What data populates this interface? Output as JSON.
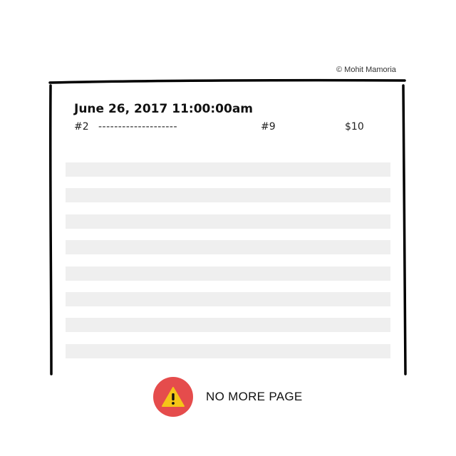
{
  "credit": "© Mohit Mamoria",
  "record": {
    "timestamp": "June 26, 2017 11:00:00am",
    "from": "#2",
    "dashes": "--------------------",
    "to": "#9",
    "amount": "$10"
  },
  "placeholder_rows": 8,
  "alert": {
    "icon": "warning-icon",
    "text": "NO MORE PAGE",
    "color": "#e54c4c",
    "icon_color": "#f5c518"
  }
}
